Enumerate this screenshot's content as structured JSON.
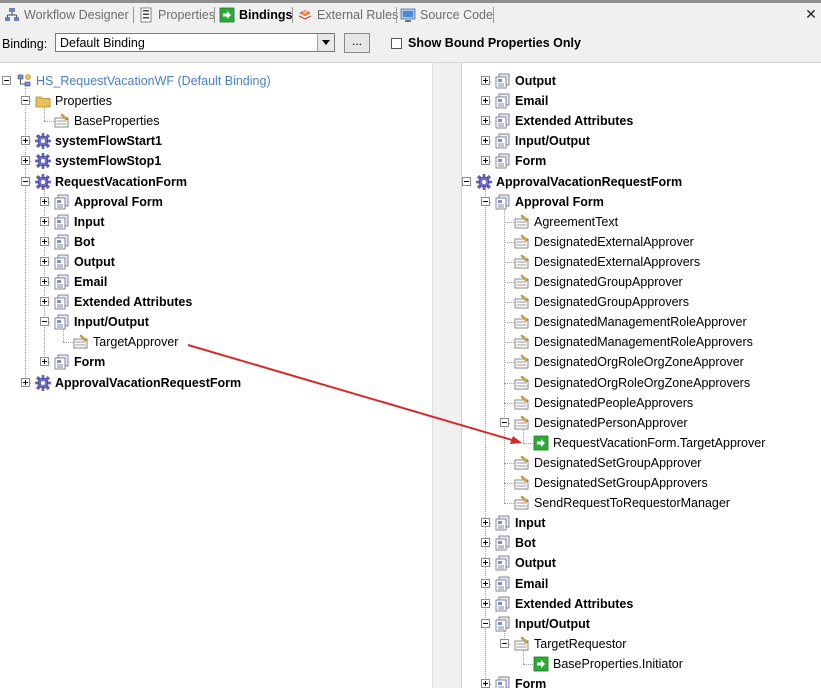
{
  "tabs": [
    {
      "label": "Workflow Designer",
      "icon": "workflow-designer-icon",
      "active": false
    },
    {
      "label": "Properties",
      "icon": "properties-icon",
      "active": false
    },
    {
      "label": "Bindings",
      "icon": "bindings-icon",
      "active": true
    },
    {
      "label": "External Rules",
      "icon": "external-rules-icon",
      "active": false
    },
    {
      "label": "Source Code",
      "icon": "source-code-icon",
      "active": false
    }
  ],
  "close_glyph": "✕",
  "binding_bar": {
    "label": "Binding:",
    "selected": "Default Binding",
    "browse_label": "...",
    "show_bound_label": "Show Bound Properties Only",
    "show_bound_checked": false
  },
  "left_tree": [
    {
      "label": "HS_RequestVacationWF (Default Binding)",
      "icon": "workflow-icon",
      "depth": 0,
      "expander": "minus",
      "link": true
    },
    {
      "label": "Properties",
      "icon": "folder-icon",
      "depth": 1,
      "expander": "minus"
    },
    {
      "label": "BaseProperties",
      "icon": "property-icon",
      "depth": 2,
      "expander": "none"
    },
    {
      "label": "systemFlowStart1",
      "icon": "gear-icon",
      "depth": 1,
      "expander": "plus",
      "bold": true
    },
    {
      "label": "systemFlowStop1",
      "icon": "gear-icon",
      "depth": 1,
      "expander": "plus",
      "bold": true
    },
    {
      "label": "RequestVacationForm",
      "icon": "gear-icon",
      "depth": 1,
      "expander": "minus",
      "bold": true
    },
    {
      "label": "Approval Form",
      "icon": "form-section-icon",
      "depth": 2,
      "expander": "plus",
      "bold": true
    },
    {
      "label": "Input",
      "icon": "form-section-icon",
      "depth": 2,
      "expander": "plus",
      "bold": true
    },
    {
      "label": "Bot",
      "icon": "form-section-icon",
      "depth": 2,
      "expander": "plus",
      "bold": true
    },
    {
      "label": "Output",
      "icon": "form-section-icon",
      "depth": 2,
      "expander": "plus",
      "bold": true
    },
    {
      "label": "Email",
      "icon": "form-section-icon",
      "depth": 2,
      "expander": "plus",
      "bold": true
    },
    {
      "label": "Extended Attributes",
      "icon": "form-section-icon",
      "depth": 2,
      "expander": "plus",
      "bold": true
    },
    {
      "label": "Input/Output",
      "icon": "form-section-icon",
      "depth": 2,
      "expander": "minus",
      "bold": true
    },
    {
      "label": "TargetApprover",
      "icon": "property-icon",
      "depth": 3,
      "expander": "none"
    },
    {
      "label": "Form",
      "icon": "form-section-icon",
      "depth": 2,
      "expander": "plus",
      "bold": true
    },
    {
      "label": "ApprovalVacationRequestForm",
      "icon": "gear-icon",
      "depth": 1,
      "expander": "plus",
      "bold": true
    }
  ],
  "right_tree": [
    {
      "label": "Output",
      "icon": "form-section-icon",
      "depth": 1,
      "expander": "plus",
      "bold": true
    },
    {
      "label": "Email",
      "icon": "form-section-icon",
      "depth": 1,
      "expander": "plus",
      "bold": true
    },
    {
      "label": "Extended Attributes",
      "icon": "form-section-icon",
      "depth": 1,
      "expander": "plus",
      "bold": true
    },
    {
      "label": "Input/Output",
      "icon": "form-section-icon",
      "depth": 1,
      "expander": "plus",
      "bold": true
    },
    {
      "label": "Form",
      "icon": "form-section-icon",
      "depth": 1,
      "expander": "plus",
      "bold": true
    },
    {
      "label": "ApprovalVacationRequestForm",
      "icon": "gear-icon",
      "depth": 0,
      "expander": "minus",
      "bold": true
    },
    {
      "label": "Approval Form",
      "icon": "form-section-icon",
      "depth": 1,
      "expander": "minus",
      "bold": true
    },
    {
      "label": "AgreementText",
      "icon": "property-icon",
      "depth": 2,
      "expander": "none"
    },
    {
      "label": "DesignatedExternalApprover",
      "icon": "property-icon",
      "depth": 2,
      "expander": "none"
    },
    {
      "label": "DesignatedExternalApprovers",
      "icon": "property-icon",
      "depth": 2,
      "expander": "none"
    },
    {
      "label": "DesignatedGroupApprover",
      "icon": "property-icon",
      "depth": 2,
      "expander": "none"
    },
    {
      "label": "DesignatedGroupApprovers",
      "icon": "property-icon",
      "depth": 2,
      "expander": "none"
    },
    {
      "label": "DesignatedManagementRoleApprover",
      "icon": "property-icon",
      "depth": 2,
      "expander": "none"
    },
    {
      "label": "DesignatedManagementRoleApprovers",
      "icon": "property-icon",
      "depth": 2,
      "expander": "none"
    },
    {
      "label": "DesignatedOrgRoleOrgZoneApprover",
      "icon": "property-icon",
      "depth": 2,
      "expander": "none"
    },
    {
      "label": "DesignatedOrgRoleOrgZoneApprovers",
      "icon": "property-icon",
      "depth": 2,
      "expander": "none"
    },
    {
      "label": "DesignatedPeopleApprovers",
      "icon": "property-icon",
      "depth": 2,
      "expander": "none"
    },
    {
      "label": "DesignatedPersonApprover",
      "icon": "property-icon",
      "depth": 2,
      "expander": "minus"
    },
    {
      "label": "RequestVacationForm.TargetApprover",
      "icon": "binding-arrow-icon",
      "depth": 3,
      "expander": "none"
    },
    {
      "label": "DesignatedSetGroupApprover",
      "icon": "property-icon",
      "depth": 2,
      "expander": "none"
    },
    {
      "label": "DesignatedSetGroupApprovers",
      "icon": "property-icon",
      "depth": 2,
      "expander": "none"
    },
    {
      "label": "SendRequestToRequestorManager",
      "icon": "property-icon",
      "depth": 2,
      "expander": "none"
    },
    {
      "label": "Input",
      "icon": "form-section-icon",
      "depth": 1,
      "expander": "plus",
      "bold": true
    },
    {
      "label": "Bot",
      "icon": "form-section-icon",
      "depth": 1,
      "expander": "plus",
      "bold": true
    },
    {
      "label": "Output",
      "icon": "form-section-icon",
      "depth": 1,
      "expander": "plus",
      "bold": true
    },
    {
      "label": "Email",
      "icon": "form-section-icon",
      "depth": 1,
      "expander": "plus",
      "bold": true
    },
    {
      "label": "Extended Attributes",
      "icon": "form-section-icon",
      "depth": 1,
      "expander": "plus",
      "bold": true
    },
    {
      "label": "Input/Output",
      "icon": "form-section-icon",
      "depth": 1,
      "expander": "minus",
      "bold": true
    },
    {
      "label": "TargetRequestor",
      "icon": "property-icon",
      "depth": 2,
      "expander": "minus"
    },
    {
      "label": "BaseProperties.Initiator",
      "icon": "binding-arrow-icon",
      "depth": 3,
      "expander": "none"
    },
    {
      "label": "Form",
      "icon": "form-section-icon",
      "depth": 1,
      "expander": "plus",
      "bold": true
    }
  ],
  "colors": {
    "link_text": "#4a7fc1",
    "binding_line": "#d42a2a",
    "binding_icon": "#2fa83a",
    "folder": "#e8c15a",
    "gear": "#6f6fc8"
  }
}
